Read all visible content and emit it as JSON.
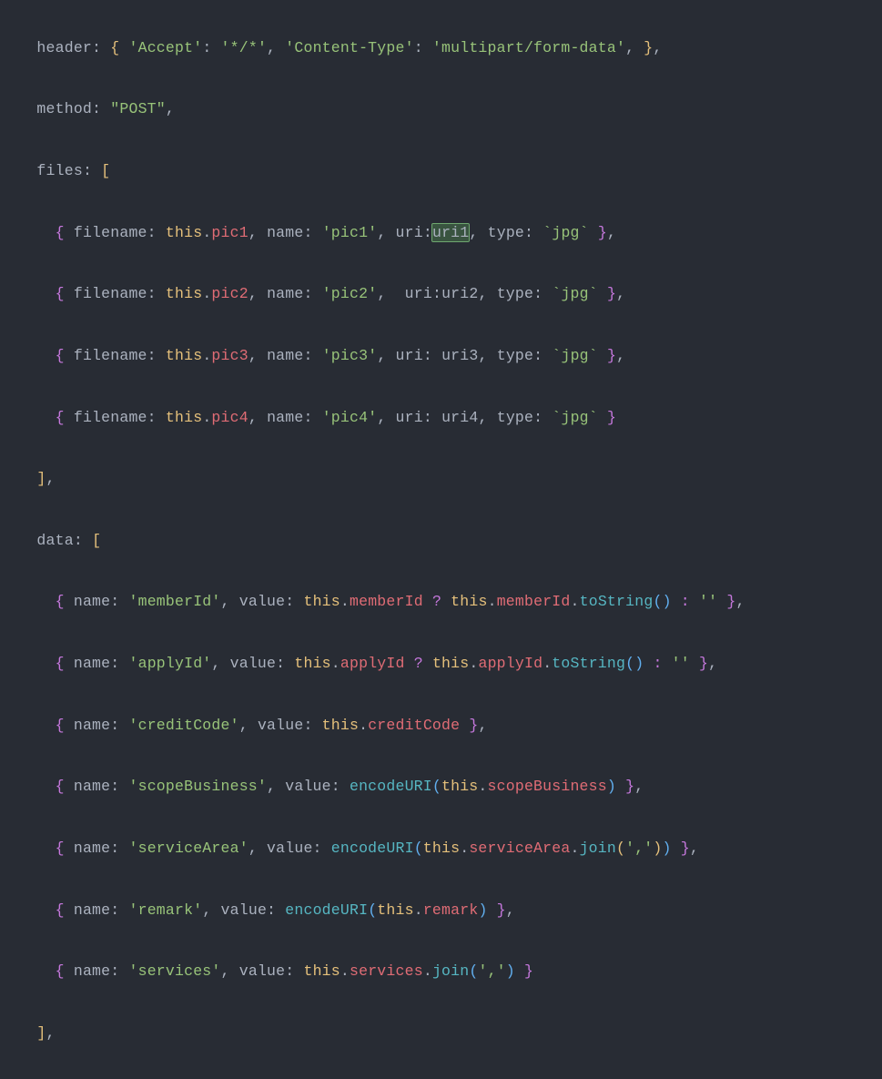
{
  "header": {
    "key": "header",
    "accept_k": "'Accept'",
    "accept_v": "'*/*'",
    "ctype_k": "'Content-Type'",
    "ctype_v": "'multipart/form-data'"
  },
  "method": {
    "key": "method",
    "value": "\"POST\""
  },
  "files_key": "files",
  "files": [
    {
      "filename_k": "filename",
      "filename_v": "pic1",
      "name_k": "name",
      "name_v": "'pic1'",
      "uri_k": "uri",
      "uri_v": "uri1",
      "type_k": "type",
      "type_v": "`jpg`",
      "hl": true
    },
    {
      "filename_k": "filename",
      "filename_v": "pic2",
      "name_k": "name",
      "name_v": "'pic2'",
      "uri_k": "uri",
      "uri_v": "uri2",
      "type_k": "type",
      "type_v": "`jpg`"
    },
    {
      "filename_k": "filename",
      "filename_v": "pic3",
      "name_k": "name",
      "name_v": "'pic3'",
      "uri_k": "uri",
      "uri_v": "uri3",
      "type_k": "type",
      "type_v": "`jpg`"
    },
    {
      "filename_k": "filename",
      "filename_v": "pic4",
      "name_k": "name",
      "name_v": "'pic4'",
      "uri_k": "uri",
      "uri_v": "uri4",
      "type_k": "type",
      "type_v": "`jpg`"
    }
  ],
  "data_key": "data",
  "data": [
    {
      "name": "'memberId'",
      "value_txt": "memberId",
      "mode": "ternary"
    },
    {
      "name": "'applyId'",
      "value_txt": "applyId",
      "mode": "ternary"
    },
    {
      "name": "'creditCode'",
      "value_txt": "creditCode",
      "mode": "plain"
    },
    {
      "name": "'scopeBusiness'",
      "value_txt": "scopeBusiness",
      "mode": "encode"
    },
    {
      "name": "'serviceArea'",
      "value_txt": "serviceArea",
      "mode": "encodejoin"
    },
    {
      "name": "'remark'",
      "value_txt": "remark",
      "mode": "encode"
    },
    {
      "name": "'services'",
      "value_txt": "services",
      "mode": "join"
    }
  ],
  "tokens": {
    "this": "this",
    "toString": "toString",
    "encodeURI": "encodeURI",
    "join": "join",
    "empty": "''",
    "comma_str": "','",
    "name_k": "name",
    "value_k": "value"
  }
}
